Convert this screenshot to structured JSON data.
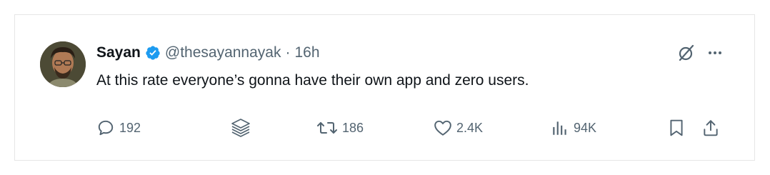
{
  "tweet": {
    "author_name": "Sayan",
    "handle": "@thesayannayak",
    "separator": "·",
    "time": "16h",
    "text": "At this rate everyone’s gonna have their own app and zero users."
  },
  "icons": {
    "verified": "verified-badge-icon",
    "grok": "grok-icon",
    "more": "more-icon",
    "reply": "reply-icon",
    "layers": "layers-icon",
    "retweet": "retweet-icon",
    "like": "heart-icon",
    "views": "views-icon",
    "bookmark": "bookmark-icon",
    "share": "share-icon"
  },
  "metrics": {
    "replies": "192",
    "retweets": "186",
    "likes": "2.4K",
    "views": "94K"
  },
  "colors": {
    "verified": "#1d9bf0",
    "secondary_text": "#536471",
    "primary_text": "#0f1419",
    "border": "#e6e6e6"
  }
}
